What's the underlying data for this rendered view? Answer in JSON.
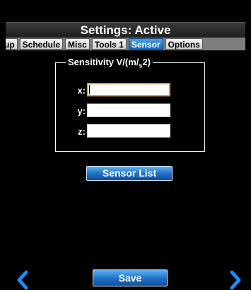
{
  "header": {
    "title": "Settings: Active"
  },
  "tabs": [
    {
      "label": "up",
      "active": false
    },
    {
      "label": "Schedule",
      "active": false
    },
    {
      "label": "Misc",
      "active": false
    },
    {
      "label": "Tools 1",
      "active": false
    },
    {
      "label": "Sensor",
      "active": true
    },
    {
      "label": "Options",
      "active": false
    }
  ],
  "sensitivity": {
    "legend_prefix": "Sensitivity V/(m/",
    "legend_sub": "s",
    "legend_suffix": "2)",
    "fields": [
      {
        "label": "x:",
        "value": ""
      },
      {
        "label": "y:",
        "value": ""
      },
      {
        "label": "z:",
        "value": ""
      }
    ]
  },
  "buttons": {
    "sensor_list": "Sensor List",
    "save": "Save"
  },
  "icons": {
    "prev": "chevron-left-icon",
    "next": "chevron-right-icon"
  },
  "colors": {
    "accent": "#1d6fc6",
    "focus": "#e8a000",
    "tab_bar": "#7d7d7d"
  }
}
